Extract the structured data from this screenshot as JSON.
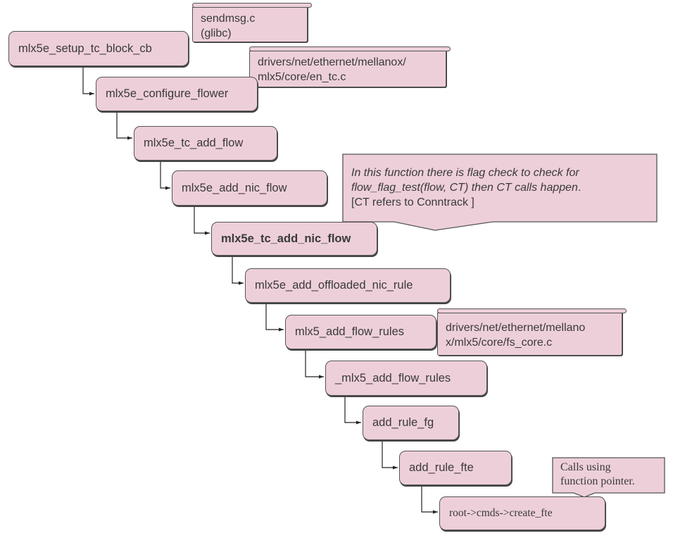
{
  "functions": [
    {
      "id": "n1",
      "label": "mlx5e_setup_tc_block_cb",
      "bold": false
    },
    {
      "id": "n2",
      "label": "mlx5e_configure_flower",
      "bold": false
    },
    {
      "id": "n3",
      "label": "mlx5e_tc_add_flow",
      "bold": false
    },
    {
      "id": "n4",
      "label": "mlx5e_add_nic_flow",
      "bold": false
    },
    {
      "id": "n5",
      "label": "mlx5e_tc_add_nic_flow",
      "bold": true
    },
    {
      "id": "n6",
      "label": "mlx5e_add_offloaded_nic_rule",
      "bold": false
    },
    {
      "id": "n7",
      "label": "mlx5_add_flow_rules",
      "bold": false
    },
    {
      "id": "n8",
      "label": "_mlx5_add_flow_rules",
      "bold": false
    },
    {
      "id": "n9",
      "label": "add_rule_fg",
      "bold": false
    },
    {
      "id": "n10",
      "label": "add_rule_fte",
      "bold": false
    },
    {
      "id": "n11",
      "label": "root->cmds->create_fte",
      "bold": false
    }
  ],
  "source_notes": [
    {
      "line1": "sendmsg.c",
      "line2": "(glibc)"
    },
    {
      "line1": "drivers/net/ethernet/mellanox/",
      "line2": "mlx5/core/en_tc.c"
    },
    {
      "line1": "drivers/net/ethernet/mellano",
      "line2": "x/mlx5/core/fs_core.c"
    }
  ],
  "callouts": {
    "ct_note": {
      "line1": "In this function there is flag check to check for",
      "line2_italic": "flow_flag_test(flow, CT) then CT calls happen",
      "line2_tail": ".",
      "line3": "[CT refers to Conntrack ]"
    },
    "fp_note": {
      "line1": "Calls using",
      "line2": "function pointer."
    }
  },
  "colors": {
    "node_fill": "#edcfda",
    "stroke": "#555555"
  }
}
